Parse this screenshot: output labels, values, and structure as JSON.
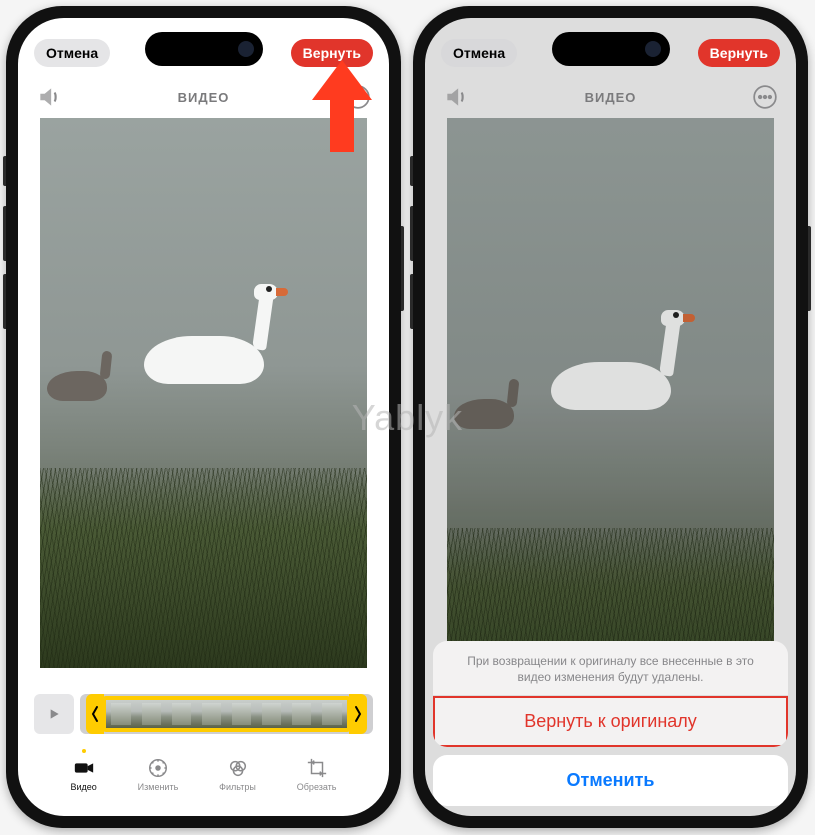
{
  "watermark": "Yablyk",
  "left": {
    "cancel_label": "Отмена",
    "revert_label": "Вернуть",
    "section_title": "ВИДЕО",
    "tools": [
      {
        "id": "video",
        "label": "Видео",
        "active": true
      },
      {
        "id": "adjust",
        "label": "Изменить",
        "active": false
      },
      {
        "id": "filters",
        "label": "Фильтры",
        "active": false
      },
      {
        "id": "crop",
        "label": "Обрезать",
        "active": false
      }
    ]
  },
  "right": {
    "cancel_label": "Отмена",
    "revert_label": "Вернуть",
    "section_title": "ВИДЕО",
    "sheet": {
      "message": "При возвращении к оригиналу все внесенные в это видео изменения будут удалены.",
      "revert_to_original": "Вернуть к оригиналу",
      "cancel": "Отменить"
    }
  }
}
